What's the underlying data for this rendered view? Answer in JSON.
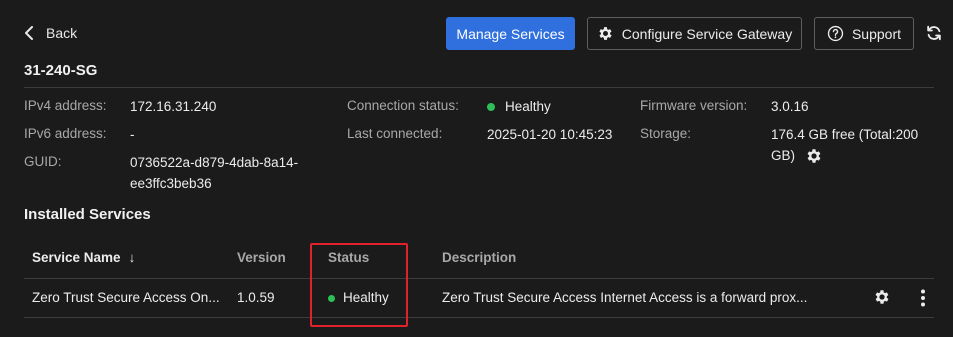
{
  "nav": {
    "back_label": "Back"
  },
  "toolbar": {
    "manage_services_label": "Manage Services",
    "configure_gateway_label": "Configure Service Gateway",
    "support_label": "Support"
  },
  "gateway": {
    "name": "31-240-SG",
    "ipv4_label": "IPv4 address:",
    "ipv4_value": "172.16.31.240",
    "ipv6_label": "IPv6 address:",
    "ipv6_value": "-",
    "guid_label": "GUID:",
    "guid_value_line1": "0736522a-d879-4dab-8a14-",
    "guid_value_line2": "ee3ffc3beb36",
    "connection_status_label": "Connection status:",
    "connection_status_value": "Healthy",
    "last_connected_label": "Last connected:",
    "last_connected_value": "2025-01-20 10:45:23",
    "firmware_label": "Firmware version:",
    "firmware_value": "3.0.16",
    "storage_label": "Storage:",
    "storage_value_line1": "176.4 GB free (Total:200",
    "storage_value_line2": "GB)"
  },
  "installed_services": {
    "title": "Installed Services",
    "columns": {
      "name": "Service Name",
      "version": "Version",
      "status": "Status",
      "description": "Description"
    },
    "sort_indicator": "↓",
    "rows": [
      {
        "name": "Zero Trust Secure Access On...",
        "version": "1.0.59",
        "status": "Healthy",
        "description": "Zero Trust Secure Access Internet Access is a forward prox..."
      }
    ]
  },
  "colors": {
    "primary": "#2f6fde",
    "healthy": "#2fbf57",
    "highlight": "#e2222a",
    "background": "#1b1b1b"
  },
  "icons": {
    "back": "chevron-left-icon",
    "configure": "gear-icon",
    "support": "question-circle-icon",
    "refresh": "refresh-icon",
    "storage_settings": "gear-icon",
    "row_settings": "gear-icon",
    "row_more": "more-vertical-icon"
  }
}
